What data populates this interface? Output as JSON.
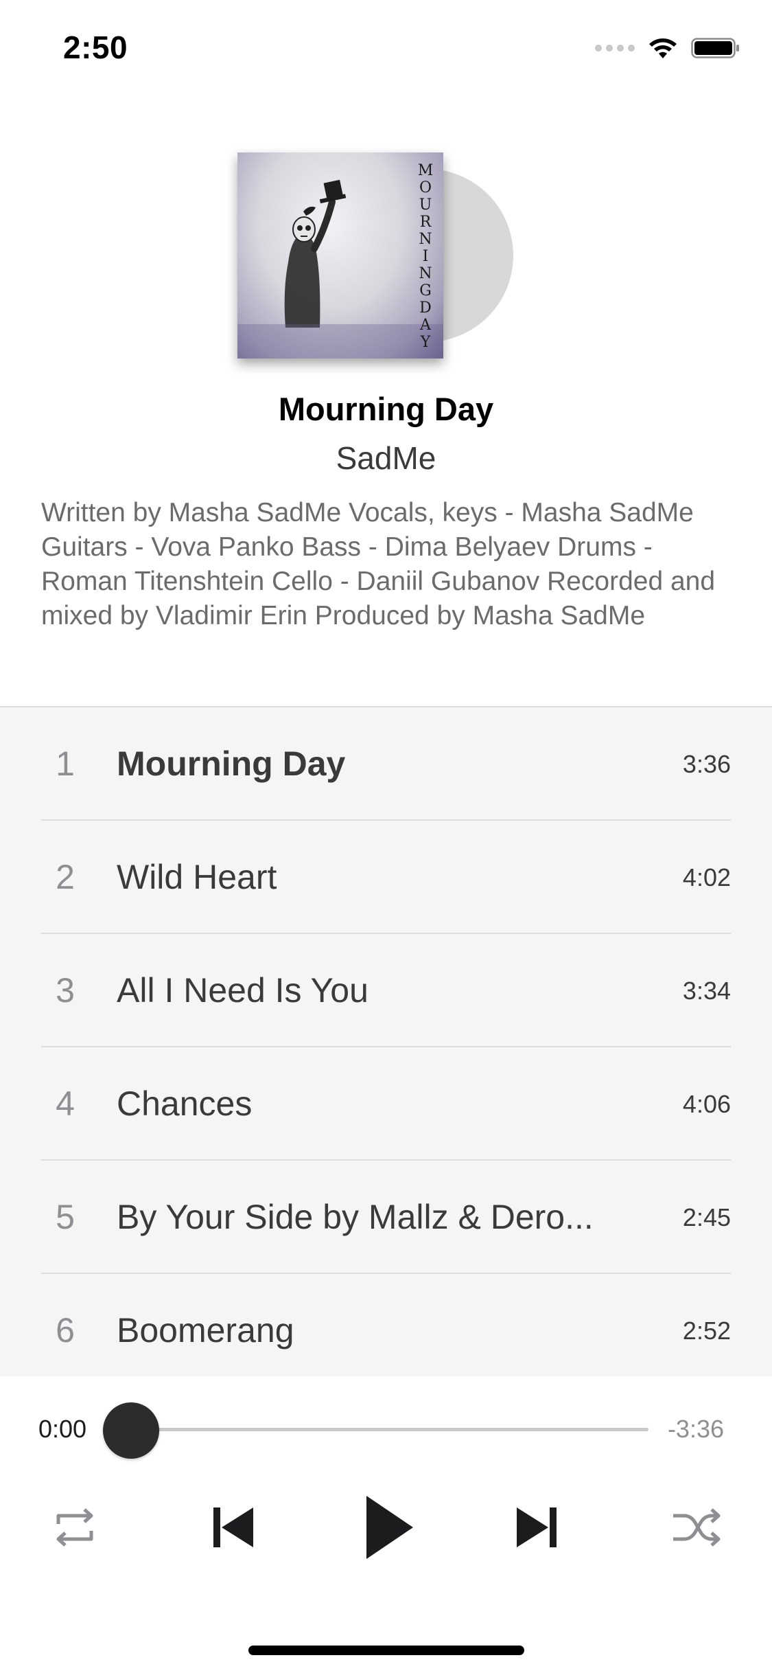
{
  "status_bar": {
    "time": "2:50"
  },
  "album": {
    "cover_text": "MOURNING DAY",
    "title": "Mourning Day",
    "artist": "SadMe",
    "credits": "Written by Masha SadMe Vocals, keys - Masha SadMe Guitars - Vova Panko Bass - Dima Belyaev Drums - Roman Titenshtein Cello - Daniil Gubanov Recorded and mixed by Vladimir Erin Produced by Masha SadMe"
  },
  "tracks": [
    {
      "number": "1",
      "title": "Mourning Day",
      "duration": "3:36",
      "current": true
    },
    {
      "number": "2",
      "title": "Wild Heart",
      "duration": "4:02"
    },
    {
      "number": "3",
      "title": "All I Need Is You",
      "duration": "3:34"
    },
    {
      "number": "4",
      "title": "Chances",
      "duration": "4:06"
    },
    {
      "number": "5",
      "title": "By Your Side by Mallz & Dero...",
      "duration": "2:45"
    },
    {
      "number": "6",
      "title": "Boomerang",
      "duration": "2:52"
    }
  ],
  "player": {
    "elapsed": "0:00",
    "remaining": "-3:36",
    "progress": 0
  },
  "icons": {
    "repeat": "repeat-icon",
    "previous": "skip-back-icon",
    "play": "play-icon",
    "next": "skip-forward-icon",
    "shuffle": "shuffle-icon"
  },
  "colors": {
    "accent": "#2c2c2e",
    "track_background": "#f5f5f5",
    "secondary_text": "#8e8e93"
  }
}
